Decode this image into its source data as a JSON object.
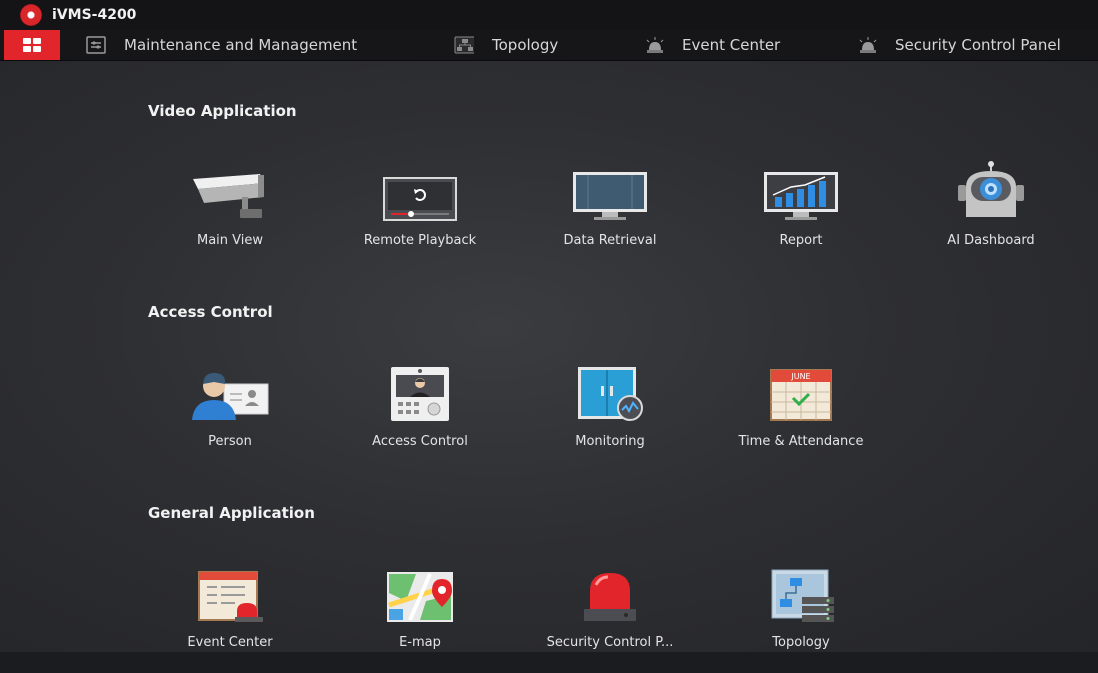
{
  "app": {
    "title": "iVMS-4200"
  },
  "nav": {
    "tabs": [
      {
        "label": "Maintenance and Management",
        "icon": "maintenance-icon"
      },
      {
        "label": "Topology",
        "icon": "topology-icon"
      },
      {
        "label": "Event Center",
        "icon": "alarm-light-icon"
      },
      {
        "label": "Security Control Panel",
        "icon": "alarm-light-icon"
      }
    ]
  },
  "sections": {
    "video": {
      "title": "Video Application",
      "items": [
        {
          "label": "Main View",
          "icon": "camera-icon"
        },
        {
          "label": "Remote Playback",
          "icon": "playback-icon"
        },
        {
          "label": "Data Retrieval",
          "icon": "monitor-icon"
        },
        {
          "label": "Report",
          "icon": "report-chart-icon"
        },
        {
          "label": "AI Dashboard",
          "icon": "robot-icon"
        }
      ]
    },
    "access": {
      "title": "Access Control",
      "items": [
        {
          "label": "Person",
          "icon": "person-card-icon"
        },
        {
          "label": "Access Control",
          "icon": "intercom-icon"
        },
        {
          "label": "Monitoring",
          "icon": "door-monitor-icon"
        },
        {
          "label": "Time & Attendance",
          "icon": "calendar-icon",
          "calendar_month": "JUNE"
        }
      ]
    },
    "general": {
      "title": "General Application",
      "items": [
        {
          "label": "Event Center",
          "icon": "event-list-icon"
        },
        {
          "label": "E-map",
          "icon": "map-pin-icon"
        },
        {
          "label": "Security Control P...",
          "icon": "siren-icon"
        },
        {
          "label": "Topology",
          "icon": "topology-server-icon"
        }
      ]
    }
  }
}
